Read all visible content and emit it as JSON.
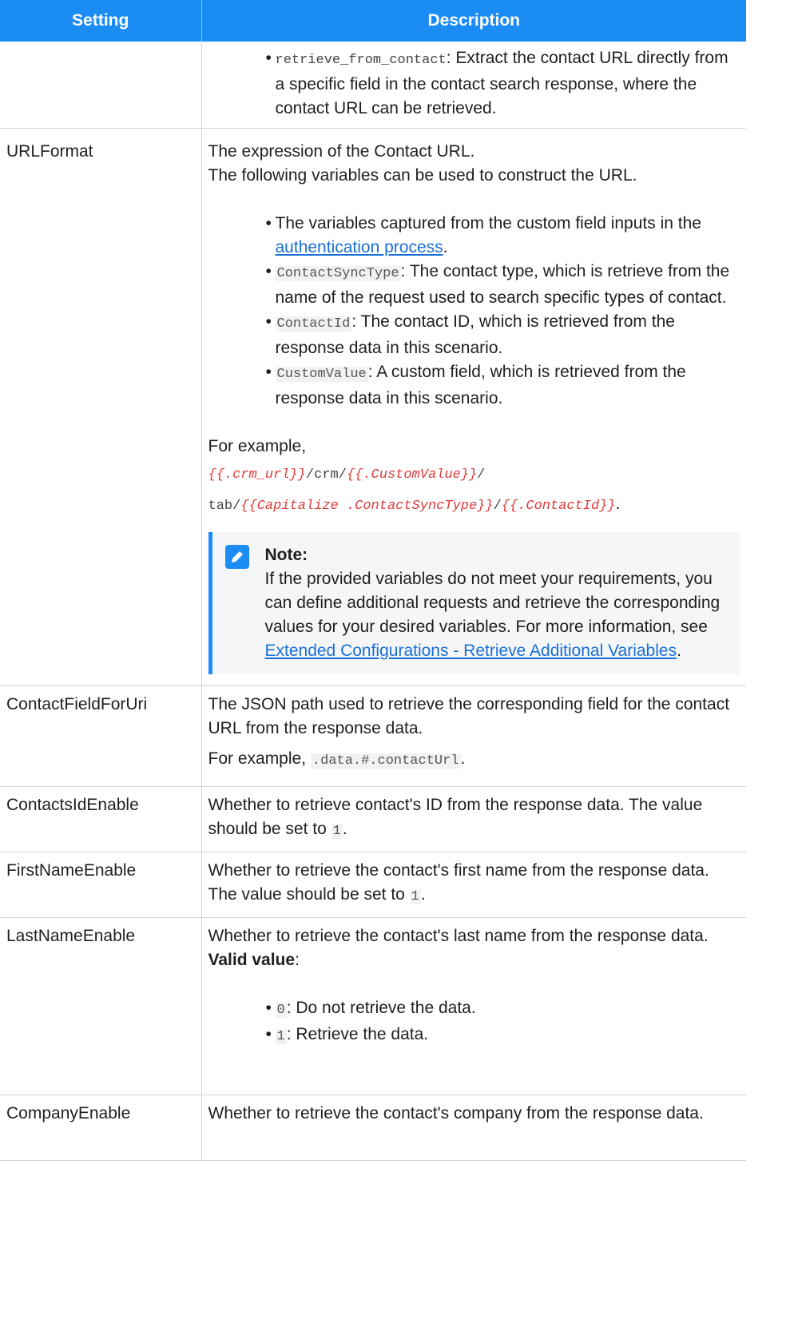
{
  "table": {
    "headers": {
      "setting": "Setting",
      "description": "Description"
    },
    "row0": {
      "bullet": {
        "code": "retrieve_from_contact",
        "text": ": Extract the contact URL directly from a specific field in the contact search response, where the contact URL can be retrieved."
      }
    },
    "row_urlformat": {
      "setting": "URLFormat",
      "line1": "The expression of the Contact URL.",
      "line2": "The following variables can be used to construct the URL.",
      "bullets": {
        "b1_pre": "The variables captured from the custom field inputs in the ",
        "b1_link": "authentication process",
        "b1_post": ".",
        "b2_code": "ContactSyncType",
        "b2_text": ": The contact type, which is retrieve from the name of the request used to search specific types of contact.",
        "b3_code": "ContactId",
        "b3_text": ": The contact ID, which is retrieved from the response data in this scenario.",
        "b4_code": "CustomValue",
        "b4_text": ": A custom field, which is retrieved from the response data in this scenario."
      },
      "example_label": "For example,",
      "example": {
        "v1": "{{.crm_url}}",
        "p1": "/crm/",
        "v2": "{{.CustomValue}}",
        "p2": "/",
        "p3": "tab/",
        "v3": "{{Capitalize .ContactSyncType}}",
        "p4": "/",
        "v4": "{{.ContactId}}",
        "end": "."
      },
      "note": {
        "title": "Note:",
        "text": "If the provided variables do not meet your requirements, you can define additional requests and retrieve the corresponding values for your desired variables. For more information, see ",
        "link": "Extended Configurations - Retrieve Additional Variables",
        "end": "."
      }
    },
    "row_contactfield": {
      "setting": "ContactFieldForUri",
      "text": "The JSON path used to retrieve the corresponding field for the contact URL from the response data.",
      "example_pre": "For example, ",
      "example_code": ".data.#.contactUrl",
      "example_end": "."
    },
    "row_contactsid": {
      "setting": "ContactsIdEnable",
      "text": "Whether to retrieve contact's ID from the response data. The value should be set to ",
      "code": "1",
      "end": "."
    },
    "row_firstname": {
      "setting": "FirstNameEnable",
      "text": "Whether to retrieve the contact's first name from the response data. The value should be set to ",
      "code": "1",
      "end": "."
    },
    "row_lastname": {
      "setting": "LastNameEnable",
      "text": "Whether to retrieve the contact's last name from the response data.",
      "valid_label": "Valid value",
      "valid_colon": ":",
      "b1_code": "0",
      "b1_text": ": Do not retrieve the data.",
      "b2_code": "1",
      "b2_text": ": Retrieve the data."
    },
    "row_company": {
      "setting": "CompanyEnable",
      "text": "Whether to retrieve the contact's company from the response data."
    }
  },
  "colors": {
    "header_bg": "#1c8cf5",
    "link": "#1a6fd6",
    "code_var": "#e03a3a",
    "note_border": "#1c8cf5"
  }
}
